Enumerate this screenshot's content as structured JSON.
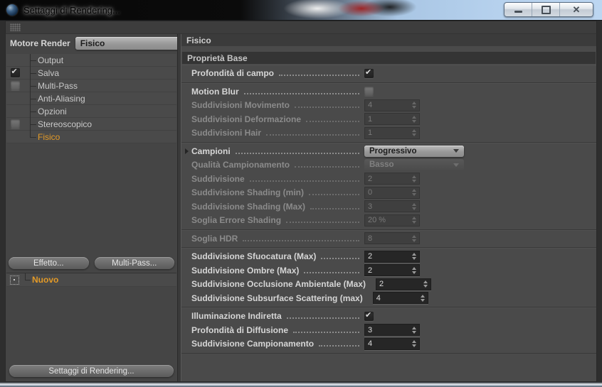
{
  "window": {
    "title": "Settaggi di Rendering..."
  },
  "sidebar": {
    "engine_label": "Motore Render",
    "engine_value": "Fisico",
    "tree": [
      {
        "label": "Output"
      },
      {
        "label": "Salva",
        "checkbox": true,
        "checked": true
      },
      {
        "label": "Multi-Pass",
        "checkbox": true,
        "checked": false
      },
      {
        "label": "Anti-Aliasing"
      },
      {
        "label": "Opzioni"
      },
      {
        "label": "Stereoscopico",
        "checkbox": true,
        "checked": false
      },
      {
        "label": "Fisico",
        "selected": true,
        "last": true
      }
    ],
    "effect_button": "Effetto...",
    "multipass_button": "Multi-Pass...",
    "new_item": "Nuovo",
    "bottom_button": "Settaggi di Rendering..."
  },
  "panel": {
    "header": "Fisico",
    "section": "Proprietà Base",
    "groups": [
      {
        "rows": [
          {
            "label": "Profondità di campo",
            "type": "checkbox",
            "checked": true,
            "enabled": true
          }
        ]
      },
      {
        "rows": [
          {
            "label": "Motion Blur",
            "type": "checkbox",
            "checked": false,
            "enabled": true
          },
          {
            "label": "Suddivisioni Movimento",
            "type": "spinner",
            "value": "4",
            "enabled": false
          },
          {
            "label": "Suddivisioni Deformazione",
            "type": "spinner",
            "value": "1",
            "enabled": false
          },
          {
            "label": "Suddivisioni Hair",
            "type": "spinner",
            "value": "1",
            "enabled": false
          }
        ]
      },
      {
        "rows": [
          {
            "label": "Campioni",
            "type": "dropdown",
            "value": "Progressivo",
            "enabled": true,
            "expander": true
          },
          {
            "label": "Qualità Campionamento",
            "type": "dropdown",
            "value": "Basso",
            "enabled": false
          },
          {
            "label": "Suddivisione",
            "type": "spinner",
            "value": "2",
            "enabled": false
          },
          {
            "label": "Suddivisione Shading (min)",
            "type": "spinner",
            "value": "0",
            "enabled": false
          },
          {
            "label": "Suddivisione Shading (Max)",
            "type": "spinner",
            "value": "3",
            "enabled": false
          },
          {
            "label": "Soglia Errore Shading",
            "type": "spinner",
            "value": "20 %",
            "enabled": false
          }
        ]
      },
      {
        "rows": [
          {
            "label": "Soglia HDR",
            "type": "spinner",
            "value": "8",
            "enabled": false
          }
        ]
      },
      {
        "rows": [
          {
            "label": "Suddivisione Sfuocatura (Max)",
            "type": "spinner",
            "value": "2",
            "enabled": true
          },
          {
            "label": "Suddivisione Ombre (Max)",
            "type": "spinner",
            "value": "2",
            "enabled": true
          },
          {
            "label": "Suddivisione Occlusione Ambientale (Max)",
            "type": "spinner",
            "value": "2",
            "enabled": true
          },
          {
            "label": "Suddivisione Subsurface Scattering (max)",
            "type": "spinner",
            "value": "4",
            "enabled": true
          }
        ]
      },
      {
        "rows": [
          {
            "label": "Illuminazione Indiretta",
            "type": "checkbox",
            "checked": true,
            "enabled": true
          },
          {
            "label": "Profondità di Diffusione",
            "type": "spinner",
            "value": "3",
            "enabled": true
          },
          {
            "label": "Suddivisione Campionamento",
            "type": "spinner",
            "value": "4",
            "enabled": true
          }
        ]
      }
    ]
  },
  "colors": {
    "accent_orange": "#E39A27",
    "panel_bg": "#4A4A4A",
    "header_bg": "#3B3B3B",
    "section_bg": "#343434",
    "field_bg": "#262626",
    "label_text": "#D6D6D6",
    "disabled_text": "#8B8B8B"
  }
}
